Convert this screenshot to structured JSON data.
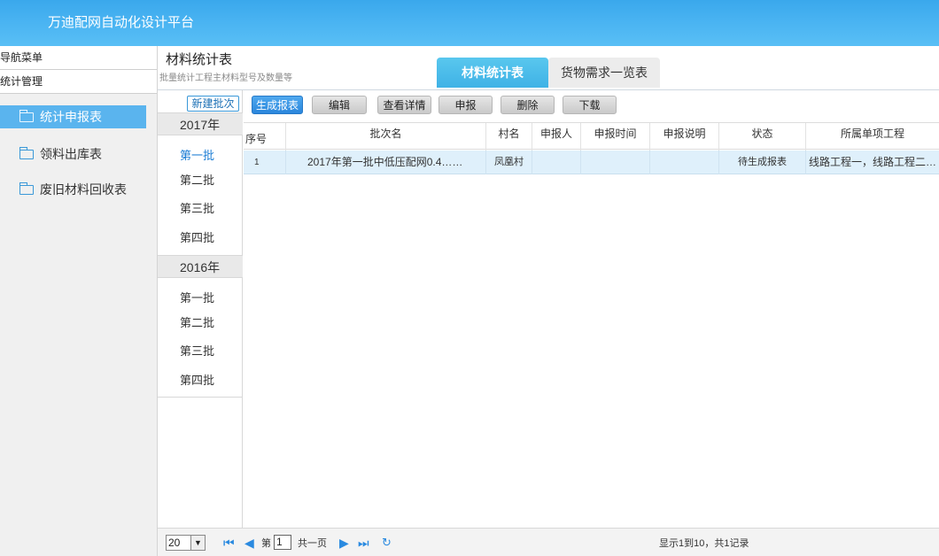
{
  "app": {
    "title": "万迪配网自动化设计平台"
  },
  "sidebar": {
    "header": "导航菜单",
    "section": "统计管理",
    "items": [
      {
        "label": "统计申报表",
        "active": true
      },
      {
        "label": "领料出库表",
        "active": false
      },
      {
        "label": "废旧材料回收表",
        "active": false
      }
    ]
  },
  "page": {
    "title": "材料统计表",
    "subtitle": "批量统计工程主材料型号及数量等"
  },
  "tabs": [
    {
      "label": "材料统计表",
      "active": true
    },
    {
      "label": "货物需求一览表",
      "active": false
    }
  ],
  "batches": {
    "new_button": "新建批次",
    "years": [
      {
        "year": "2017年",
        "items": [
          "第一批",
          "第二批",
          "第三批",
          "第四批"
        ],
        "active_index": 0
      },
      {
        "year": "2016年",
        "items": [
          "第一批",
          "第二批",
          "第三批",
          "第四批"
        ],
        "active_index": -1
      }
    ]
  },
  "toolbar": {
    "generate": "生成报表",
    "edit": "编辑",
    "details": "查看详情",
    "report": "申报",
    "delete": "删除",
    "download": "下载"
  },
  "table": {
    "columns": [
      "序号",
      "批次名",
      "村名",
      "申报人",
      "申报时间",
      "申报说明",
      "状态",
      "所属单项工程"
    ],
    "rows": [
      [
        "1",
        "2017年第一批中低压配网0.4……",
        "凤凰村",
        "",
        "",
        "",
        "待生成报表",
        "线路工程一，线路工程二…"
      ]
    ]
  },
  "pagination": {
    "page_size": "20",
    "page_prefix": "第",
    "page_value": "1",
    "total_pages": "共一页",
    "summary": "显示1到10，共1记录"
  }
}
